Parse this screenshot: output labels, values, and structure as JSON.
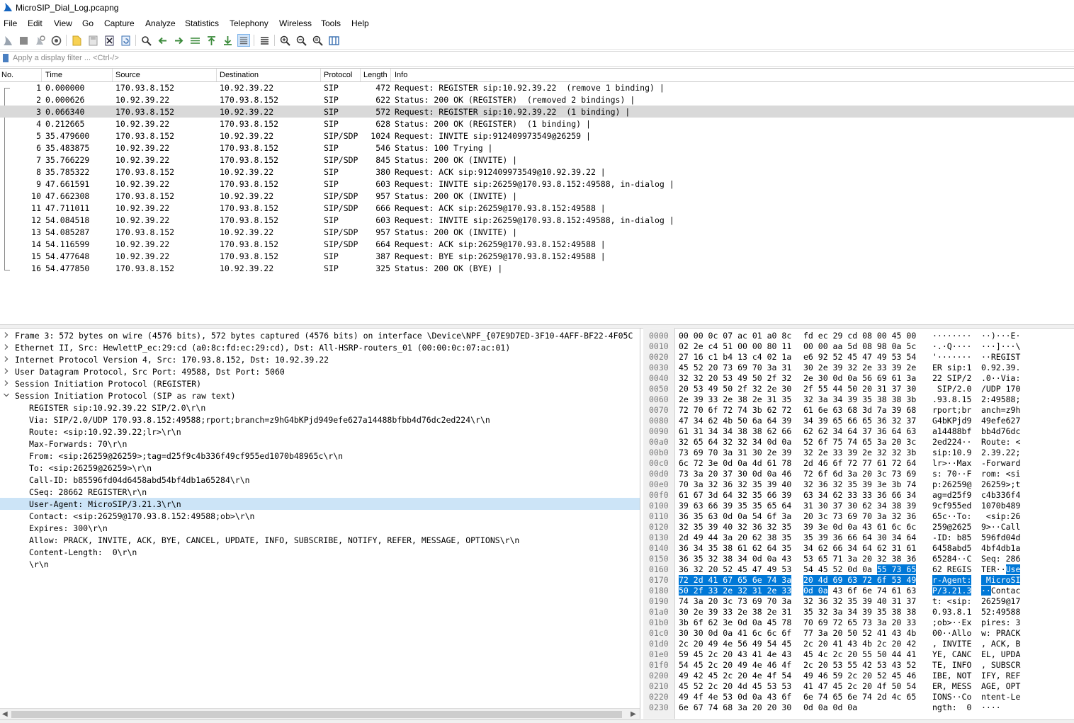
{
  "window": {
    "title": "MicroSIP_Dial_Log.pcapng"
  },
  "menu": [
    "File",
    "Edit",
    "View",
    "Go",
    "Capture",
    "Analyze",
    "Statistics",
    "Telephony",
    "Wireless",
    "Tools",
    "Help"
  ],
  "toolbar": {
    "icons": [
      "start-capture-icon",
      "stop-capture-icon",
      "restart-capture-icon",
      "capture-options-icon",
      "open-file-icon",
      "save-file-icon",
      "close-file-icon",
      "reload-file-icon",
      "find-packet-icon",
      "go-back-icon",
      "go-forward-icon",
      "go-to-packet-icon",
      "go-first-packet-icon",
      "go-last-packet-icon",
      "auto-scroll-icon",
      "colorize-icon",
      "zoom-in-icon",
      "zoom-out-icon",
      "normal-size-icon",
      "resize-columns-icon"
    ]
  },
  "filter": {
    "placeholder": "Apply a display filter ... <Ctrl-/>"
  },
  "packet_list": {
    "columns": [
      "No.",
      "Time",
      "Source",
      "Destination",
      "Protocol",
      "Length",
      "Info"
    ],
    "selected_index": 2,
    "rows": [
      {
        "no": "1",
        "time": "0.000000",
        "src": "170.93.8.152",
        "dst": "10.92.39.22",
        "proto": "SIP",
        "len": "472",
        "info": "Request: REGISTER sip:10.92.39.22  (remove 1 binding) |"
      },
      {
        "no": "2",
        "time": "0.000626",
        "src": "10.92.39.22",
        "dst": "170.93.8.152",
        "proto": "SIP",
        "len": "622",
        "info": "Status: 200 OK (REGISTER)  (removed 2 bindings) |"
      },
      {
        "no": "3",
        "time": "0.066340",
        "src": "170.93.8.152",
        "dst": "10.92.39.22",
        "proto": "SIP",
        "len": "572",
        "info": "Request: REGISTER sip:10.92.39.22  (1 binding) |"
      },
      {
        "no": "4",
        "time": "0.212665",
        "src": "10.92.39.22",
        "dst": "170.93.8.152",
        "proto": "SIP",
        "len": "628",
        "info": "Status: 200 OK (REGISTER)  (1 binding) |"
      },
      {
        "no": "5",
        "time": "35.479600",
        "src": "170.93.8.152",
        "dst": "10.92.39.22",
        "proto": "SIP/SDP",
        "len": "1024",
        "info": "Request: INVITE sip:912409973549@26259 |"
      },
      {
        "no": "6",
        "time": "35.483875",
        "src": "10.92.39.22",
        "dst": "170.93.8.152",
        "proto": "SIP",
        "len": "546",
        "info": "Status: 100 Trying |"
      },
      {
        "no": "7",
        "time": "35.766229",
        "src": "10.92.39.22",
        "dst": "170.93.8.152",
        "proto": "SIP/SDP",
        "len": "845",
        "info": "Status: 200 OK (INVITE) |"
      },
      {
        "no": "8",
        "time": "35.785322",
        "src": "170.93.8.152",
        "dst": "10.92.39.22",
        "proto": "SIP",
        "len": "380",
        "info": "Request: ACK sip:912409973549@10.92.39.22 |"
      },
      {
        "no": "9",
        "time": "47.661591",
        "src": "10.92.39.22",
        "dst": "170.93.8.152",
        "proto": "SIP",
        "len": "603",
        "info": "Request: INVITE sip:26259@170.93.8.152:49588, in-dialog |"
      },
      {
        "no": "10",
        "time": "47.662308",
        "src": "170.93.8.152",
        "dst": "10.92.39.22",
        "proto": "SIP/SDP",
        "len": "957",
        "info": "Status: 200 OK (INVITE) |"
      },
      {
        "no": "11",
        "time": "47.711011",
        "src": "10.92.39.22",
        "dst": "170.93.8.152",
        "proto": "SIP/SDP",
        "len": "666",
        "info": "Request: ACK sip:26259@170.93.8.152:49588 |"
      },
      {
        "no": "12",
        "time": "54.084518",
        "src": "10.92.39.22",
        "dst": "170.93.8.152",
        "proto": "SIP",
        "len": "603",
        "info": "Request: INVITE sip:26259@170.93.8.152:49588, in-dialog |"
      },
      {
        "no": "13",
        "time": "54.085287",
        "src": "170.93.8.152",
        "dst": "10.92.39.22",
        "proto": "SIP/SDP",
        "len": "957",
        "info": "Status: 200 OK (INVITE) |"
      },
      {
        "no": "14",
        "time": "54.116599",
        "src": "10.92.39.22",
        "dst": "170.93.8.152",
        "proto": "SIP/SDP",
        "len": "664",
        "info": "Request: ACK sip:26259@170.93.8.152:49588 |"
      },
      {
        "no": "15",
        "time": "54.477648",
        "src": "10.92.39.22",
        "dst": "170.93.8.152",
        "proto": "SIP",
        "len": "387",
        "info": "Request: BYE sip:26259@170.93.8.152:49588 |"
      },
      {
        "no": "16",
        "time": "54.477850",
        "src": "170.93.8.152",
        "dst": "10.92.39.22",
        "proto": "SIP",
        "len": "325",
        "info": "Status: 200 OK (BYE) |"
      }
    ]
  },
  "details": {
    "selected_index": 14,
    "rows": [
      {
        "level": 0,
        "tw": "collapsed",
        "text": "Frame 3: 572 bytes on wire (4576 bits), 572 bytes captured (4576 bits) on interface \\Device\\NPF_{07E9D7ED-3F10-4AFF-BF22-4F05C"
      },
      {
        "level": 0,
        "tw": "collapsed",
        "text": "Ethernet II, Src: HewlettP_ec:29:cd (a0:8c:fd:ec:29:cd), Dst: All-HSRP-routers_01 (00:00:0c:07:ac:01)"
      },
      {
        "level": 0,
        "tw": "collapsed",
        "text": "Internet Protocol Version 4, Src: 170.93.8.152, Dst: 10.92.39.22"
      },
      {
        "level": 0,
        "tw": "collapsed",
        "text": "User Datagram Protocol, Src Port: 49588, Dst Port: 5060"
      },
      {
        "level": 0,
        "tw": "collapsed",
        "text": "Session Initiation Protocol (REGISTER)"
      },
      {
        "level": 0,
        "tw": "expanded",
        "text": "Session Initiation Protocol (SIP as raw text)"
      },
      {
        "level": 1,
        "tw": "none",
        "text": "REGISTER sip:10.92.39.22 SIP/2.0\\r\\n"
      },
      {
        "level": 1,
        "tw": "none",
        "text": "Via: SIP/2.0/UDP 170.93.8.152:49588;rport;branch=z9hG4bKPjd949efe627a14488bfbb4d76dc2ed224\\r\\n"
      },
      {
        "level": 1,
        "tw": "none",
        "text": "Route: <sip:10.92.39.22;lr>\\r\\n"
      },
      {
        "level": 1,
        "tw": "none",
        "text": "Max-Forwards: 70\\r\\n"
      },
      {
        "level": 1,
        "tw": "none",
        "text": "From: <sip:26259@26259>;tag=d25f9c4b336f49cf955ed1070b48965c\\r\\n"
      },
      {
        "level": 1,
        "tw": "none",
        "text": "To: <sip:26259@26259>\\r\\n"
      },
      {
        "level": 1,
        "tw": "none",
        "text": "Call-ID: b85596fd04d6458abd54bf4db1a65284\\r\\n"
      },
      {
        "level": 1,
        "tw": "none",
        "text": "CSeq: 28662 REGISTER\\r\\n"
      },
      {
        "level": 1,
        "tw": "none",
        "text": "User-Agent: MicroSIP/3.21.3\\r\\n"
      },
      {
        "level": 1,
        "tw": "none",
        "text": "Contact: <sip:26259@170.93.8.152:49588;ob>\\r\\n"
      },
      {
        "level": 1,
        "tw": "none",
        "text": "Expires: 300\\r\\n"
      },
      {
        "level": 1,
        "tw": "none",
        "text": "Allow: PRACK, INVITE, ACK, BYE, CANCEL, UPDATE, INFO, SUBSCRIBE, NOTIFY, REFER, MESSAGE, OPTIONS\\r\\n"
      },
      {
        "level": 1,
        "tw": "none",
        "text": "Content-Length:  0\\r\\n"
      },
      {
        "level": 1,
        "tw": "none",
        "text": "\\r\\n"
      }
    ]
  },
  "hex": {
    "rows": [
      {
        "off": "0000",
        "b1": "00 00 0c 07 ac 01 a0 8c",
        "b2": "fd ec 29 cd 08 00 45 00",
        "a1": "········",
        "a2": "··)···E·"
      },
      {
        "off": "0010",
        "b1": "02 2e c4 51 00 00 80 11",
        "b2": "00 00 aa 5d 08 98 0a 5c",
        "a1": "·.·Q····",
        "a2": "···]···\\"
      },
      {
        "off": "0020",
        "b1": "27 16 c1 b4 13 c4 02 1a",
        "b2": "e6 92 52 45 47 49 53 54",
        "a1": "'·······",
        "a2": "··REGIST"
      },
      {
        "off": "0030",
        "b1": "45 52 20 73 69 70 3a 31",
        "b2": "30 2e 39 32 2e 33 39 2e",
        "a1": "ER sip:1",
        "a2": "0.92.39."
      },
      {
        "off": "0040",
        "b1": "32 32 20 53 49 50 2f 32",
        "b2": "2e 30 0d 0a 56 69 61 3a",
        "a1": "22 SIP/2",
        "a2": ".0··Via:"
      },
      {
        "off": "0050",
        "b1": "20 53 49 50 2f 32 2e 30",
        "b2": "2f 55 44 50 20 31 37 30",
        "a1": " SIP/2.0",
        "a2": "/UDP 170"
      },
      {
        "off": "0060",
        "b1": "2e 39 33 2e 38 2e 31 35",
        "b2": "32 3a 34 39 35 38 38 3b",
        "a1": ".93.8.15",
        "a2": "2:49588;"
      },
      {
        "off": "0070",
        "b1": "72 70 6f 72 74 3b 62 72",
        "b2": "61 6e 63 68 3d 7a 39 68",
        "a1": "rport;br",
        "a2": "anch=z9h"
      },
      {
        "off": "0080",
        "b1": "47 34 62 4b 50 6a 64 39",
        "b2": "34 39 65 66 65 36 32 37",
        "a1": "G4bKPjd9",
        "a2": "49efe627"
      },
      {
        "off": "0090",
        "b1": "61 31 34 34 38 38 62 66",
        "b2": "62 62 34 64 37 36 64 63",
        "a1": "a14488bf",
        "a2": "bb4d76dc"
      },
      {
        "off": "00a0",
        "b1": "32 65 64 32 32 34 0d 0a",
        "b2": "52 6f 75 74 65 3a 20 3c",
        "a1": "2ed224··",
        "a2": "Route: <"
      },
      {
        "off": "00b0",
        "b1": "73 69 70 3a 31 30 2e 39",
        "b2": "32 2e 33 39 2e 32 32 3b",
        "a1": "sip:10.9",
        "a2": "2.39.22;"
      },
      {
        "off": "00c0",
        "b1": "6c 72 3e 0d 0a 4d 61 78",
        "b2": "2d 46 6f 72 77 61 72 64",
        "a1": "lr>··Max",
        "a2": "-Forward"
      },
      {
        "off": "00d0",
        "b1": "73 3a 20 37 30 0d 0a 46",
        "b2": "72 6f 6d 3a 20 3c 73 69",
        "a1": "s: 70··F",
        "a2": "rom: <si"
      },
      {
        "off": "00e0",
        "b1": "70 3a 32 36 32 35 39 40",
        "b2": "32 36 32 35 39 3e 3b 74",
        "a1": "p:26259@",
        "a2": "26259>;t"
      },
      {
        "off": "00f0",
        "b1": "61 67 3d 64 32 35 66 39",
        "b2": "63 34 62 33 33 36 66 34",
        "a1": "ag=d25f9",
        "a2": "c4b336f4"
      },
      {
        "off": "0100",
        "b1": "39 63 66 39 35 35 65 64",
        "b2": "31 30 37 30 62 34 38 39",
        "a1": "9cf955ed",
        "a2": "1070b489"
      },
      {
        "off": "0110",
        "b1": "36 35 63 0d 0a 54 6f 3a",
        "b2": "20 3c 73 69 70 3a 32 36",
        "a1": "65c··To:",
        "a2": " <sip:26"
      },
      {
        "off": "0120",
        "b1": "32 35 39 40 32 36 32 35",
        "b2": "39 3e 0d 0a 43 61 6c 6c",
        "a1": "259@2625",
        "a2": "9>··Call"
      },
      {
        "off": "0130",
        "b1": "2d 49 44 3a 20 62 38 35",
        "b2": "35 39 36 66 64 30 34 64",
        "a1": "-ID: b85",
        "a2": "596fd04d"
      },
      {
        "off": "0140",
        "b1": "36 34 35 38 61 62 64 35",
        "b2": "34 62 66 34 64 62 31 61",
        "a1": "6458abd5",
        "a2": "4bf4db1a"
      },
      {
        "off": "0150",
        "b1": "36 35 32 38 34 0d 0a 43",
        "b2": "53 65 71 3a 20 32 38 36",
        "a1": "65284··C",
        "a2": "Seq: 286"
      },
      {
        "off": "0160",
        "b1": "36 32 20 52 45 47 49 53",
        "b2": "54 45 52 0d 0a |55 73 65",
        "a1": "62 REGIS",
        "a2": "TER··|Use"
      },
      {
        "off": "0170",
        "b1": "|72 2d 41 67 65 6e 74 3a",
        "b2": "|20 4d 69 63 72 6f 53 49",
        "a1": "|r-Agent:",
        "a2": "| MicroSI"
      },
      {
        "off": "0180",
        "b1": "|50 2f 33 2e 32 31 2e 33",
        "b2": "|0d 0a| 43 6f 6e 74 61 63",
        "a1": "|P/3.21.3",
        "a2": "|··|Contac"
      },
      {
        "off": "0190",
        "b1": "74 3a 20 3c 73 69 70 3a",
        "b2": "32 36 32 35 39 40 31 37",
        "a1": "t: <sip:",
        "a2": "26259@17"
      },
      {
        "off": "01a0",
        "b1": "30 2e 39 33 2e 38 2e 31",
        "b2": "35 32 3a 34 39 35 38 38",
        "a1": "0.93.8.1",
        "a2": "52:49588"
      },
      {
        "off": "01b0",
        "b1": "3b 6f 62 3e 0d 0a 45 78",
        "b2": "70 69 72 65 73 3a 20 33",
        "a1": ";ob>··Ex",
        "a2": "pires: 3"
      },
      {
        "off": "01c0",
        "b1": "30 30 0d 0a 41 6c 6c 6f",
        "b2": "77 3a 20 50 52 41 43 4b",
        "a1": "00··Allo",
        "a2": "w: PRACK"
      },
      {
        "off": "01d0",
        "b1": "2c 20 49 4e 56 49 54 45",
        "b2": "2c 20 41 43 4b 2c 20 42",
        "a1": ", INVITE",
        "a2": ", ACK, B"
      },
      {
        "off": "01e0",
        "b1": "59 45 2c 20 43 41 4e 43",
        "b2": "45 4c 2c 20 55 50 44 41",
        "a1": "YE, CANC",
        "a2": "EL, UPDA"
      },
      {
        "off": "01f0",
        "b1": "54 45 2c 20 49 4e 46 4f",
        "b2": "2c 20 53 55 42 53 43 52",
        "a1": "TE, INFO",
        "a2": ", SUBSCR"
      },
      {
        "off": "0200",
        "b1": "49 42 45 2c 20 4e 4f 54",
        "b2": "49 46 59 2c 20 52 45 46",
        "a1": "IBE, NOT",
        "a2": "IFY, REF"
      },
      {
        "off": "0210",
        "b1": "45 52 2c 20 4d 45 53 53",
        "b2": "41 47 45 2c 20 4f 50 54",
        "a1": "ER, MESS",
        "a2": "AGE, OPT"
      },
      {
        "off": "0220",
        "b1": "49 4f 4e 53 0d 0a 43 6f",
        "b2": "6e 74 65 6e 74 2d 4c 65",
        "a1": "IONS··Co",
        "a2": "ntent-Le"
      },
      {
        "off": "0230",
        "b1": "6e 67 74 68 3a 20 20 30",
        "b2": "0d 0a 0d 0a",
        "a1": "ngth:  0",
        "a2": "····"
      }
    ]
  },
  "colors": {
    "selected_packet": "#d9d9d9",
    "selected_field": "#cce4f7",
    "hex_highlight": "#0078d7",
    "accent": "#4a7fc1"
  }
}
